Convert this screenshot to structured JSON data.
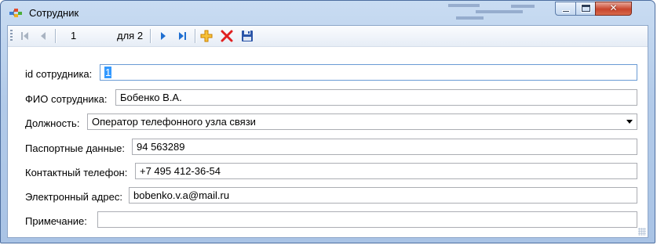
{
  "window": {
    "title": "Сотрудник"
  },
  "navigator": {
    "position": "1",
    "count_label": "для 2",
    "buttons": [
      "first",
      "previous",
      "next",
      "last",
      "add",
      "delete",
      "save"
    ]
  },
  "form": {
    "id_label": "id сотрудника:",
    "id_value": "1",
    "fio_label": "ФИО сотрудника:",
    "fio_value": "Бобенко В.А.",
    "position_label": "Должность:",
    "position_value": "Оператор телефонного узла связи",
    "passport_label": "Паспортные данные:",
    "passport_value": "94 563289",
    "phone_label": "Контактный телефон:",
    "phone_value": "+7 495 412-36-54",
    "email_label": "Электронный адрес:",
    "email_value": "bobenko.v.a@mail.ru",
    "note_label": "Примечание:",
    "note_value": ""
  },
  "colors": {
    "frame": "#b3cbe9",
    "close_button": "#c8452c",
    "nav_arrow": "#1f6fd1",
    "add_icon": "#f0a000",
    "delete_icon": "#e02020",
    "save_icon": "#2b55a8"
  }
}
